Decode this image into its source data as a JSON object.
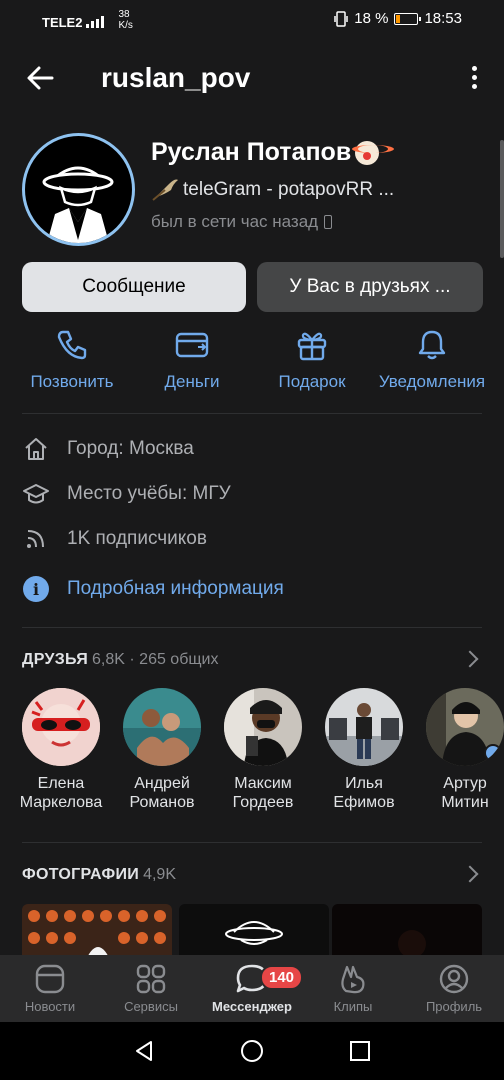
{
  "status_bar": {
    "carrier": "TELE2",
    "speed_value": "38",
    "speed_unit": "K/s",
    "battery": "18 %",
    "time": "18:53"
  },
  "header": {
    "title": "ruslan_pov"
  },
  "profile": {
    "name": "Руслан Потапов",
    "status": "teleGram - potapovRR ...",
    "online": "был в сети час назад"
  },
  "buttons": {
    "message": "Сообщение",
    "friends": "У Вас в друзьях ..."
  },
  "actions": [
    {
      "label": "Позвонить",
      "icon": "phone-icon"
    },
    {
      "label": "Деньги",
      "icon": "money-icon"
    },
    {
      "label": "Подарок",
      "icon": "gift-icon"
    },
    {
      "label": "Уведомления",
      "icon": "bell-icon"
    }
  ],
  "info": {
    "city": "Город: Москва",
    "school": "Место учёбы: МГУ",
    "followers": "1K подписчиков",
    "details": "Подробная информация"
  },
  "friends_section": {
    "title": "ДРУЗЬЯ",
    "count": "6,8K · 265 общих",
    "items": [
      {
        "first": "Елена",
        "last": "Маркелова"
      },
      {
        "first": "Андрей",
        "last": "Романов"
      },
      {
        "first": "Максим",
        "last": "Гордеев"
      },
      {
        "first": "Илья",
        "last": "Ефимов"
      },
      {
        "first": "Артур",
        "last": "Митин"
      }
    ]
  },
  "photos_section": {
    "title": "ФОТОГРАФИИ",
    "count": "4,9K"
  },
  "tabbar": {
    "items": [
      {
        "label": "Новости",
        "icon": "news-icon"
      },
      {
        "label": "Сервисы",
        "icon": "services-icon"
      },
      {
        "label": "Мессенджер",
        "icon": "messenger-icon"
      },
      {
        "label": "Клипы",
        "icon": "clips-icon"
      },
      {
        "label": "Профиль",
        "icon": "profile-icon"
      }
    ],
    "messenger_badge": "140"
  },
  "colors": {
    "background": "#19191a",
    "accent": "#71aaeb",
    "badge": "#e64646"
  }
}
